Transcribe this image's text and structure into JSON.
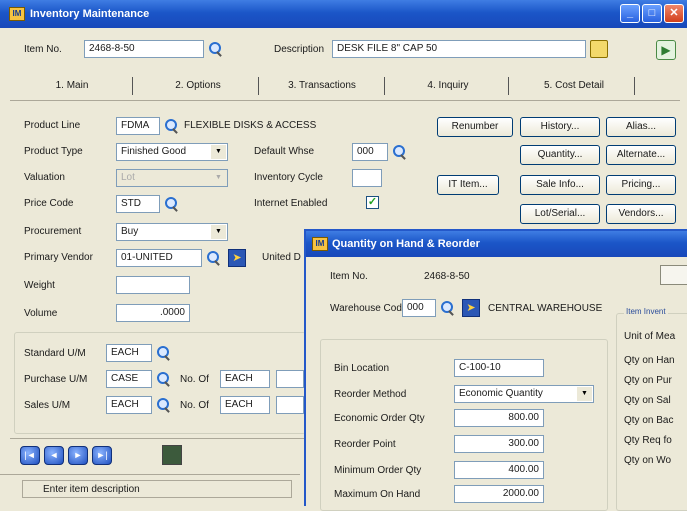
{
  "main_window": {
    "title": "Inventory Maintenance",
    "title_icon": "IM",
    "controls": {
      "minimize": "_",
      "maximize": "□",
      "close": "✕"
    }
  },
  "header": {
    "item_no_label": "Item No.",
    "item_no_value": "2468-8-50",
    "description_label": "Description",
    "description_value": "DESK FILE 8\" CAP 50"
  },
  "tabs": [
    {
      "label": "1. Main"
    },
    {
      "label": "2. Options"
    },
    {
      "label": "3. Transactions"
    },
    {
      "label": "4. Inquiry"
    },
    {
      "label": "5. Cost Detail"
    }
  ],
  "main": {
    "product_line_label": "Product Line",
    "product_line_value": "FDMA",
    "product_line_desc": "FLEXIBLE DISKS & ACCESS",
    "product_type_label": "Product Type",
    "product_type_value": "Finished Good",
    "valuation_label": "Valuation",
    "valuation_value": "Lot",
    "price_code_label": "Price Code",
    "price_code_value": "STD",
    "procurement_label": "Procurement",
    "procurement_value": "Buy",
    "primary_vendor_label": "Primary Vendor",
    "primary_vendor_value": "01-UNITED",
    "primary_vendor_desc": "United D",
    "weight_label": "Weight",
    "weight_value": "",
    "volume_label": "Volume",
    "volume_value": ".0000",
    "default_whse_label": "Default Whse",
    "default_whse_value": "000",
    "inventory_cycle_label": "Inventory Cycle",
    "inventory_cycle_value": "",
    "internet_enabled_label": "Internet Enabled",
    "internet_enabled_checked": true
  },
  "uom": {
    "standard_label": "Standard U/M",
    "standard_value": "EACH",
    "purchase_label": "Purchase U/M",
    "purchase_value": "CASE",
    "purchase_no_of_label": "No. Of",
    "purchase_no_of_value": "EACH",
    "sales_label": "Sales U/M",
    "sales_value": "EACH",
    "sales_no_of_label": "No. Of",
    "sales_no_of_value": "EACH"
  },
  "buttons": {
    "renumber": "Renumber",
    "history": "History...",
    "alias": "Alias...",
    "quantity": "Quantity...",
    "alternate": "Alternate...",
    "it_item": "IT Item...",
    "sale_info": "Sale Info...",
    "pricing": "Pricing...",
    "lot_serial": "Lot/Serial...",
    "vendors": "Vendors..."
  },
  "nav": [
    "|◄",
    "◄",
    "►",
    "►|"
  ],
  "status_text": "Enter item description",
  "qty_window": {
    "title": "Quantity on Hand & Reorder",
    "item_no_label": "Item No.",
    "item_no_value": "2468-8-50",
    "warehouse_label": "Warehouse Code",
    "warehouse_value": "000",
    "warehouse_desc": "CENTRAL WAREHOUSE",
    "bin_location_label": "Bin Location",
    "bin_location_value": "C-100-10",
    "reorder_method_label": "Reorder Method",
    "reorder_method_value": "Economic Quantity",
    "eoq_label": "Economic Order Qty",
    "eoq_value": "800.00",
    "reorder_point_label": "Reorder Point",
    "reorder_point_value": "300.00",
    "min_order_label": "Minimum Order Qty",
    "min_order_value": "400.00",
    "max_on_hand_label": "Maximum On Hand",
    "max_on_hand_value": "2000.00",
    "side_group_title": "Item Invent",
    "side_labels": [
      "Unit of Mea",
      "Qty on Han",
      "Qty on Pur",
      "Qty on Sal",
      "Qty on Bac",
      "Qty Req fo",
      "Qty on Wo"
    ]
  }
}
